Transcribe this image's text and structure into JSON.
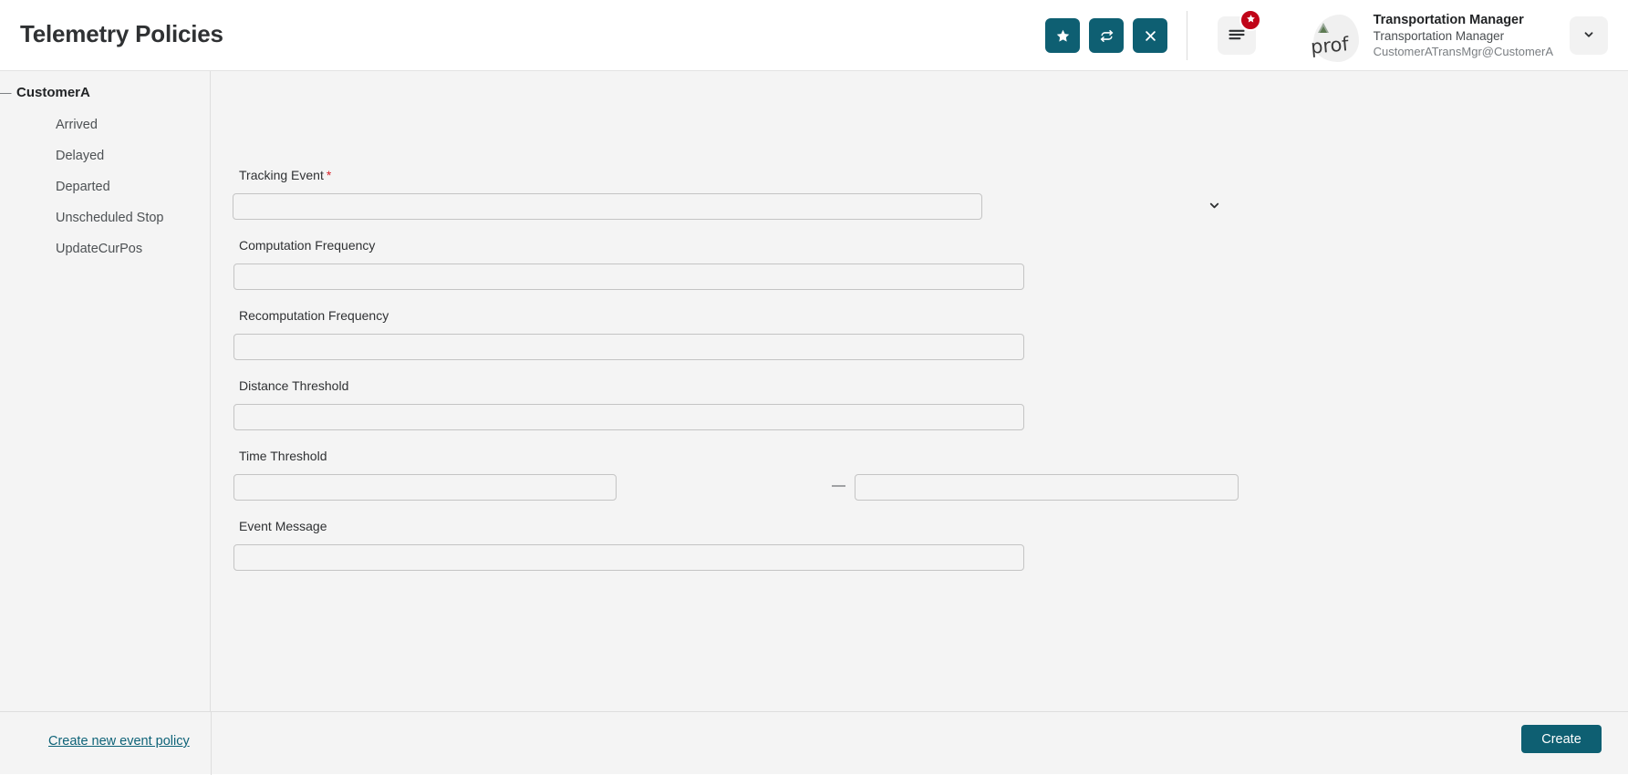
{
  "header": {
    "title": "Telemetry Policies",
    "actions": [
      {
        "name": "favorite-button",
        "icon": "star-icon"
      },
      {
        "name": "refresh-button",
        "icon": "refresh-icon"
      },
      {
        "name": "close-button",
        "icon": "close-icon"
      }
    ],
    "menu": {
      "icon": "hamburger-menu-icon",
      "badge_icon": "star-icon"
    },
    "user": {
      "avatar_alt": "prof",
      "name": "Transportation Manager",
      "role": "Transportation Manager",
      "login": "CustomerATransMgr@CustomerA",
      "dropdown_icon": "chevron-down-icon"
    }
  },
  "sidebar": {
    "root": {
      "label": "CustomerA",
      "toggle": "—"
    },
    "items": [
      {
        "label": "Arrived"
      },
      {
        "label": "Delayed"
      },
      {
        "label": "Departed"
      },
      {
        "label": "Unscheduled Stop"
      },
      {
        "label": "UpdateCurPos"
      }
    ]
  },
  "form": {
    "tracking_event": {
      "label": "Tracking Event",
      "required_marker": "*",
      "value": "",
      "placeholder": "",
      "chevron_icon": "chevron-down-icon"
    },
    "computation_frequency": {
      "label": "Computation Frequency",
      "value": "",
      "placeholder": ""
    },
    "recomputation_frequency": {
      "label": "Recomputation Frequency",
      "value": "",
      "placeholder": ""
    },
    "distance_threshold": {
      "label": "Distance Threshold",
      "value": "",
      "placeholder": ""
    },
    "time_threshold": {
      "label": "Time Threshold",
      "separator": "—",
      "from_value": "",
      "from_placeholder": "",
      "to_value": "",
      "to_placeholder": ""
    },
    "event_message": {
      "label": "Event Message",
      "value": "",
      "placeholder": ""
    }
  },
  "footer": {
    "create_link": "Create new event policy",
    "create_button": "Create"
  },
  "colors": {
    "accent": "#0e5f72",
    "accent_bar": "#085567",
    "link": "#0e6378",
    "badge": "#c00418",
    "required": "#d8232a",
    "page_bg": "#f4f4f4"
  }
}
